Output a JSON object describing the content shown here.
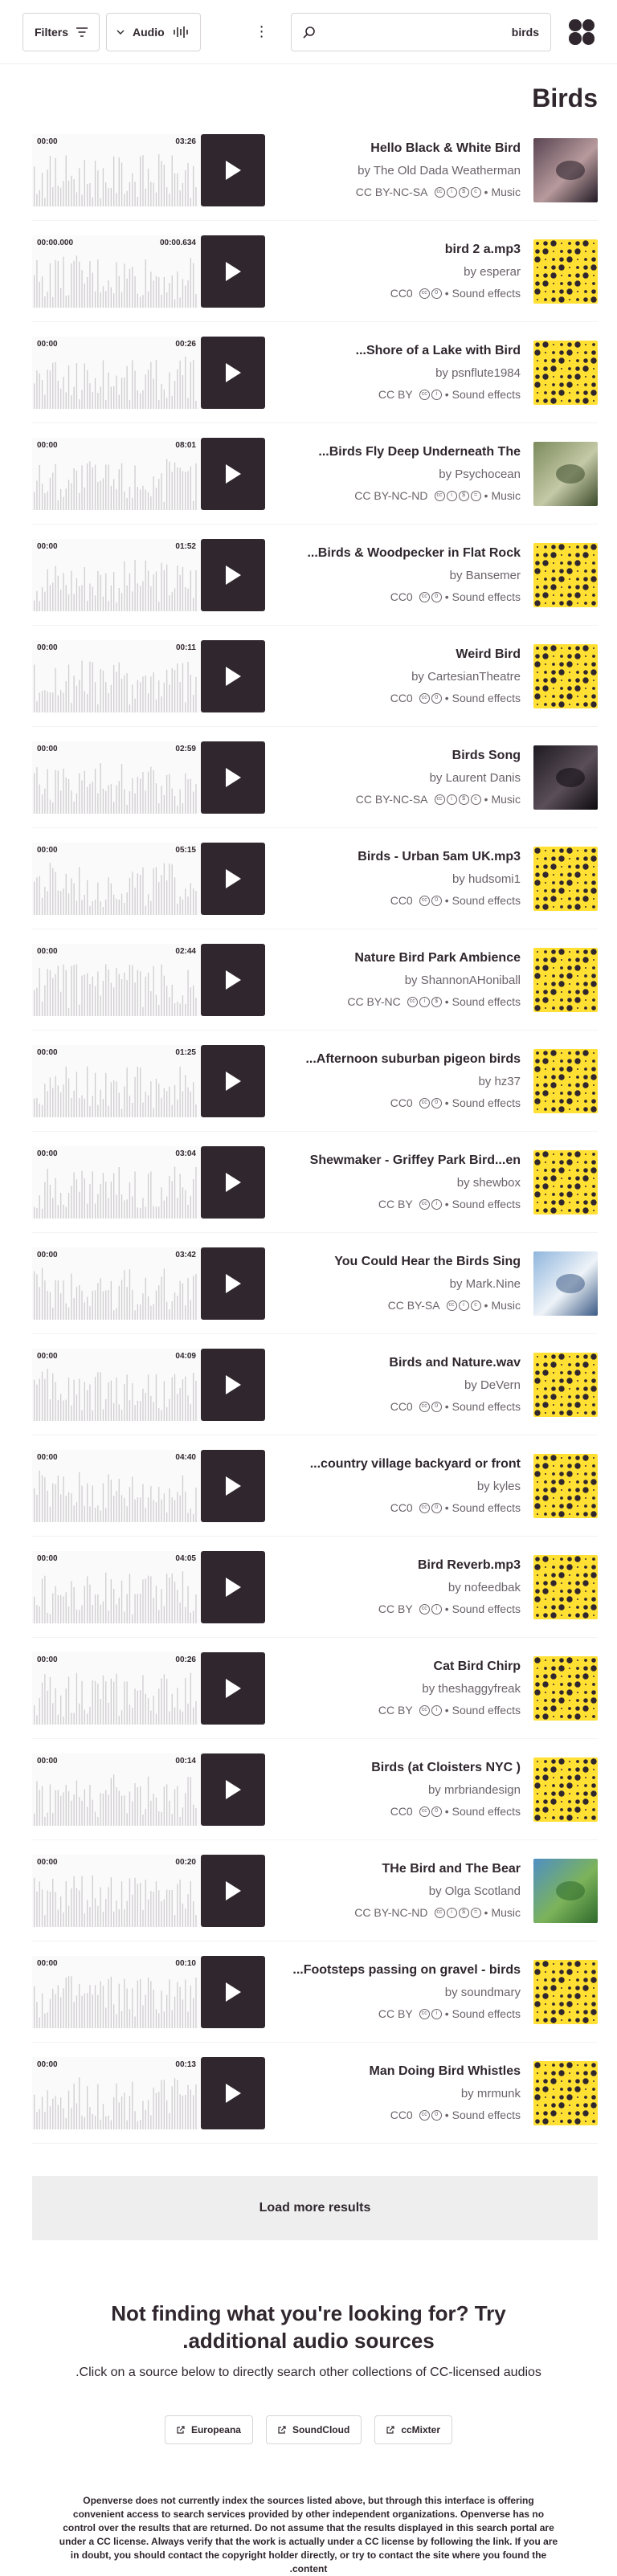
{
  "header": {
    "filters_label": "Filters",
    "media_type_label": "Audio",
    "search_value": "birds"
  },
  "page_title": "Birds",
  "results": [
    {
      "title": "Hello Black & White Bird",
      "by": "by The Old Dada Weatherman",
      "license": "CC BY-NC-SA",
      "category": "Music",
      "start": "00:00",
      "end": "03:26",
      "thumb": "photo",
      "tones": [
        "#5a4552",
        "#b79a9c",
        "#221a24"
      ],
      "icons": [
        "cc",
        "by",
        "nc",
        "sa"
      ]
    },
    {
      "title": "bird 2 a.mp3",
      "by": "by esperar",
      "license": "CC0",
      "category": "Sound effects",
      "start": "00:00.000",
      "end": "00:00.634",
      "thumb": "dots",
      "icons": [
        "cc",
        "zero"
      ]
    },
    {
      "title": "Shore of a Lake with Bird...",
      "by": "by psnflute1984",
      "license": "CC BY",
      "category": "Sound effects",
      "start": "00:00",
      "end": "00:26",
      "thumb": "dots",
      "icons": [
        "cc",
        "by"
      ]
    },
    {
      "title": "Birds Fly Deep Underneath The...",
      "by": "by Psychocean",
      "license": "CC BY-NC-ND",
      "category": "Music",
      "start": "00:00",
      "end": "08:01",
      "thumb": "photo",
      "tones": [
        "#7b8a5c",
        "#c4c9a6",
        "#3b4a2a"
      ],
      "icons": [
        "cc",
        "by",
        "nc",
        "nd"
      ]
    },
    {
      "title": "Birds & Woodpecker in Flat Rock...",
      "by": "by Bansemer",
      "license": "CC0",
      "category": "Sound effects",
      "start": "00:00",
      "end": "01:52",
      "thumb": "dots",
      "icons": [
        "cc",
        "zero"
      ]
    },
    {
      "title": "Weird Bird",
      "by": "by CartesianTheatre",
      "license": "CC0",
      "category": "Sound effects",
      "start": "00:00",
      "end": "00:11",
      "thumb": "dots",
      "icons": [
        "cc",
        "zero"
      ]
    },
    {
      "title": "Birds Song",
      "by": "by Laurent Danis",
      "license": "CC BY-NC-SA",
      "category": "Music",
      "start": "00:00",
      "end": "02:59",
      "thumb": "photo",
      "tones": [
        "#1e1a22",
        "#5a4e58",
        "#0c0a0e"
      ],
      "icons": [
        "cc",
        "by",
        "nc",
        "sa"
      ]
    },
    {
      "title": "Birds - Urban 5am UK.mp3",
      "by": "by hudsomi1",
      "license": "CC0",
      "category": "Sound effects",
      "start": "00:00",
      "end": "05:15",
      "thumb": "dots",
      "icons": [
        "cc",
        "zero"
      ]
    },
    {
      "title": "Nature Bird Park Ambience",
      "by": "by ShannonAHoniball",
      "license": "CC BY-NC",
      "category": "Sound effects",
      "start": "00:00",
      "end": "02:44",
      "thumb": "dots",
      "icons": [
        "cc",
        "by",
        "nc"
      ]
    },
    {
      "title": "Afternoon suburban pigeon birds...",
      "by": "by hz37",
      "license": "CC0",
      "category": "Sound effects",
      "start": "00:00",
      "end": "01:25",
      "thumb": "dots",
      "icons": [
        "cc",
        "zero"
      ]
    },
    {
      "title": "Shewmaker - Griffey Park Bird...en",
      "by": "by shewbox",
      "license": "CC BY",
      "category": "Sound effects",
      "start": "00:00",
      "end": "03:04",
      "thumb": "dots",
      "icons": [
        "cc",
        "by"
      ]
    },
    {
      "title": "You Could Hear the Birds Sing",
      "by": "by Mark.Nine",
      "license": "CC BY-SA",
      "category": "Music",
      "start": "00:00",
      "end": "03:42",
      "thumb": "photo",
      "tones": [
        "#8fb5dd",
        "#eef3f8",
        "#3a5a85"
      ],
      "icons": [
        "cc",
        "by",
        "sa"
      ]
    },
    {
      "title": "Birds and Nature.wav",
      "by": "by DeVern",
      "license": "CC0",
      "category": "Sound effects",
      "start": "00:00",
      "end": "04:09",
      "thumb": "dots",
      "icons": [
        "cc",
        "zero"
      ]
    },
    {
      "title": "country village backyard or front...",
      "by": "by kyles",
      "license": "CC0",
      "category": "Sound effects",
      "start": "00:00",
      "end": "04:40",
      "thumb": "dots",
      "icons": [
        "cc",
        "zero"
      ]
    },
    {
      "title": "Bird Reverb.mp3",
      "by": "by nofeedbak",
      "license": "CC BY",
      "category": "Sound effects",
      "start": "00:00",
      "end": "04:05",
      "thumb": "dots",
      "icons": [
        "cc",
        "by"
      ]
    },
    {
      "title": "Cat Bird Chirp",
      "by": "by theshaggyfreak",
      "license": "CC BY",
      "category": "Sound effects",
      "start": "00:00",
      "end": "00:26",
      "thumb": "dots",
      "icons": [
        "cc",
        "by"
      ]
    },
    {
      "title": "Birds (at Cloisters NYC )",
      "by": "by mrbriandesign",
      "license": "CC0",
      "category": "Sound effects",
      "start": "00:00",
      "end": "00:14",
      "thumb": "dots",
      "icons": [
        "cc",
        "zero"
      ]
    },
    {
      "title": "THe Bird and The Bear",
      "by": "by Olga Scotland",
      "license": "CC BY-NC-ND",
      "category": "Music",
      "start": "00:00",
      "end": "00:20",
      "thumb": "photo",
      "tones": [
        "#4f8fc4",
        "#7cb35a",
        "#2e6a2c"
      ],
      "icons": [
        "cc",
        "by",
        "nc",
        "nd"
      ]
    },
    {
      "title": "Footsteps passing on gravel - birds...",
      "by": "by soundmary",
      "license": "CC BY",
      "category": "Sound effects",
      "start": "00:00",
      "end": "00:10",
      "thumb": "dots",
      "icons": [
        "cc",
        "by"
      ]
    },
    {
      "title": "Man Doing Bird Whistles",
      "by": "by mrmunk",
      "license": "CC0",
      "category": "Sound effects",
      "start": "00:00",
      "end": "00:13",
      "thumb": "dots",
      "icons": [
        "cc",
        "zero"
      ]
    }
  ],
  "load_more_label": "Load more results",
  "more_sources": {
    "heading": "Not finding what you're looking for? Try additional audio sources.",
    "subtext": "Click on a source below to directly search other collections of CC-licensed audios.",
    "sources": [
      "Europeana",
      "SoundCloud",
      "ccMixter"
    ]
  },
  "disclaimer": "Openverse does not currently index the sources listed above, but through this interface is offering convenient access to search services provided by other independent organizations. Openverse has no control over the results that are returned. Do not assume that the results displayed in this search portal are under a CC license. Always verify that the work is actually under a CC license by following the link. If you are in doubt, you should contact the copyright holder directly, or try to contact the site where you found the content.",
  "colors": {
    "dark": "#30272e",
    "yellow": "#ffe033",
    "muted": "#6b636a"
  }
}
